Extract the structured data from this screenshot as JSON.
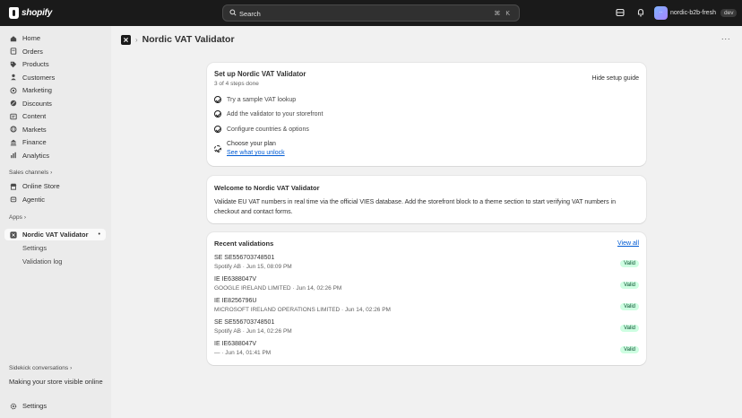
{
  "topbar": {
    "brand": "shopify",
    "search_placeholder": "Search",
    "search_shortcut": "⌘ K",
    "store_initials": "··",
    "store_name": "nordic-b2b-fresh",
    "env_badge": "dev"
  },
  "sidebar": {
    "items": [
      {
        "label": "Home",
        "icon": "home-icon"
      },
      {
        "label": "Orders",
        "icon": "orders-icon"
      },
      {
        "label": "Products",
        "icon": "tag-icon"
      },
      {
        "label": "Customers",
        "icon": "person-icon"
      },
      {
        "label": "Marketing",
        "icon": "target-icon"
      },
      {
        "label": "Discounts",
        "icon": "discount-icon"
      },
      {
        "label": "Content",
        "icon": "content-icon"
      },
      {
        "label": "Markets",
        "icon": "globe-icon"
      },
      {
        "label": "Finance",
        "icon": "bank-icon"
      },
      {
        "label": "Analytics",
        "icon": "chart-icon"
      }
    ],
    "sales_channels_label": "Sales channels",
    "sales_channels": [
      {
        "label": "Online Store",
        "icon": "store-icon"
      },
      {
        "label": "Agentic",
        "icon": "agent-icon"
      }
    ],
    "apps_label": "Apps",
    "app_name": "Nordic VAT Validator",
    "app_subitems": [
      "Settings",
      "Validation log"
    ],
    "sidekick_label": "Sidekick conversations",
    "sidekick_item": "Making your store visible online",
    "settings_label": "Settings"
  },
  "page": {
    "title": "Nordic VAT Validator",
    "more_label": "···"
  },
  "setup": {
    "title": "Set up Nordic VAT Validator",
    "progress": "3 of 4 steps done",
    "hide_label": "Hide setup guide",
    "steps": [
      {
        "label": "Try a sample VAT lookup",
        "done": true
      },
      {
        "label": "Add the validator to your storefront",
        "done": true
      },
      {
        "label": "Configure countries & options",
        "done": true
      },
      {
        "label": "Choose your plan",
        "done": false
      }
    ],
    "plan_link": "See what you unlock"
  },
  "welcome": {
    "title": "Welcome to Nordic VAT Validator",
    "body_line1": "Validate EU VAT numbers in real time via the official VIES database. Add the storefront block to a theme section to start verifying VAT numbers in",
    "body_line2": "checkout and contact forms."
  },
  "recent": {
    "title": "Recent validations",
    "view_all": "View all",
    "rows": [
      {
        "id": "SE SE556703748501",
        "meta": "Spotify AB · Jun 15, 08:09 PM",
        "status": "Valid"
      },
      {
        "id": "IE IE6388047V",
        "meta": "GOOGLE IRELAND LIMITED · Jun 14, 02:26 PM",
        "status": "Valid"
      },
      {
        "id": "IE IE8256796U",
        "meta": "MICROSOFT IRELAND OPERATIONS LIMITED · Jun 14, 02:26 PM",
        "status": "Valid"
      },
      {
        "id": "SE SE556703748501",
        "meta": "Spotify AB · Jun 14, 02:26 PM",
        "status": "Valid"
      },
      {
        "id": "IE IE6388047V",
        "meta": "— · Jun 14, 01:41 PM",
        "status": "Valid"
      }
    ]
  }
}
